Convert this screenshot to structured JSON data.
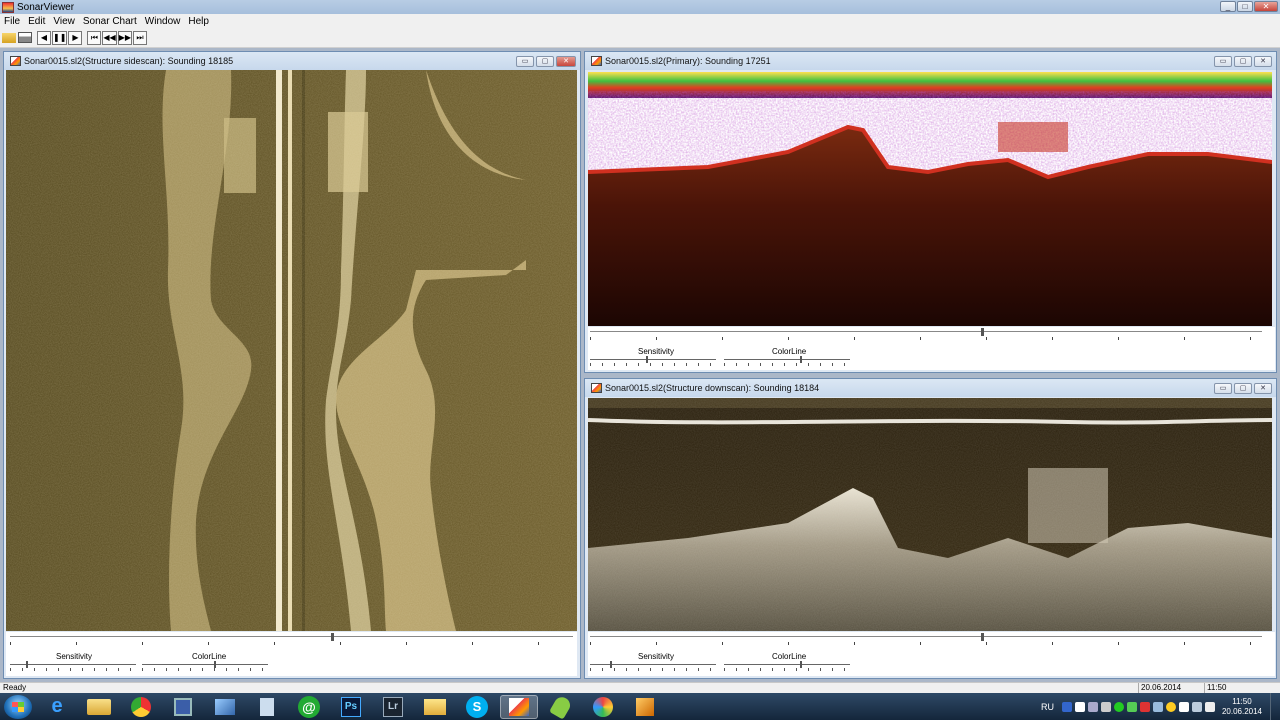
{
  "window": {
    "title": "SonarViewer"
  },
  "menu": [
    "File",
    "Edit",
    "View",
    "Sonar Chart",
    "Window",
    "Help"
  ],
  "toolbar": {
    "buttons": [
      "open-icon",
      "print-icon",
      "step-back",
      "pause",
      "play",
      "first",
      "rewind",
      "forward",
      "last"
    ],
    "glyphs": [
      "◀",
      "❚❚",
      "▶",
      "⏮",
      "◀◀",
      "▶▶",
      "⏭"
    ]
  },
  "windows": {
    "sidescan": {
      "title": "Sonar0015.sl2(Structure sidescan): Sounding 18185",
      "sensitivity_label": "Sensitivity",
      "colorline_label": "ColorLine",
      "position": 0.57
    },
    "primary": {
      "title": "Sonar0015.sl2(Primary): Sounding 17251",
      "sensitivity_label": "Sensitivity",
      "colorline_label": "ColorLine",
      "position": 0.58
    },
    "downscan": {
      "title": "Sonar0015.sl2(Structure downscan): Sounding 18184",
      "sensitivity_label": "Sensitivity",
      "colorline_label": "ColorLine",
      "position": 0.58
    }
  },
  "statusbar": {
    "text": "Ready",
    "date": "20.06.2014",
    "time": "11:50"
  },
  "taskbar": {
    "apps": [
      "ie-icon",
      "explorer-icon",
      "chrome-icon",
      "save-icon",
      "media-icon",
      "notes-icon",
      "mail-icon",
      "photoshop-icon",
      "lightroom-icon",
      "folder-icon",
      "skype-icon",
      "sonarviewer-icon",
      "android-icon",
      "browser-icon",
      "archive-icon"
    ],
    "labels": {
      "photoshop": "Ps",
      "lightroom": "Lr",
      "skype": "S"
    },
    "lang": "RU",
    "clock_time": "11:50",
    "clock_date": "20.06.2014"
  },
  "colors": {
    "sidescan_bg": "#564a20",
    "sonar_sand": "#c9b47a",
    "primary_bg": "#3a0e08",
    "downscan_bg": "#2a2010",
    "mdi_bg": "#abb7c8"
  }
}
